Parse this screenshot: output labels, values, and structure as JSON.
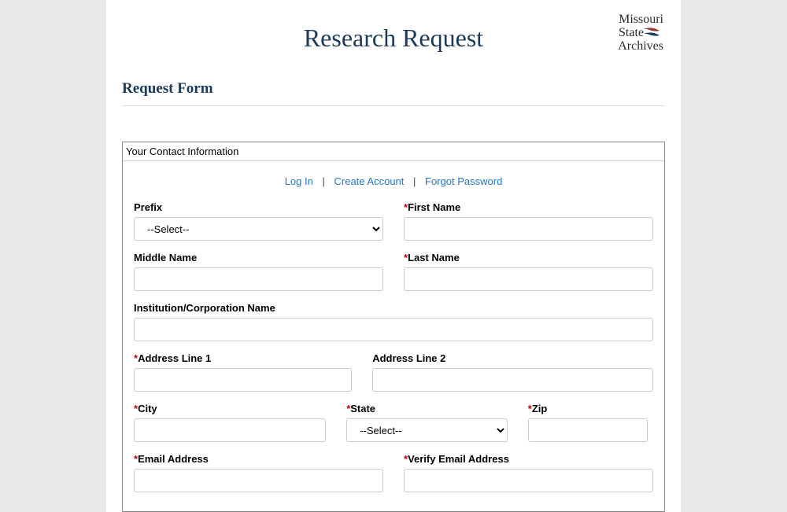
{
  "header": {
    "title": "Research Request",
    "logo_line1": "Missouri",
    "logo_line2": "State",
    "logo_line3": "Archives",
    "subhead": "Request Form"
  },
  "panel": {
    "title": "Your Contact Information"
  },
  "auth": {
    "login": "Log In",
    "create": "Create Account",
    "forgot": "Forgot Password"
  },
  "fields": {
    "prefix": {
      "label": "Prefix",
      "required": false,
      "placeholder": "--Select--"
    },
    "first_name": {
      "label": "First Name",
      "required": true
    },
    "middle_name": {
      "label": "Middle Name",
      "required": false
    },
    "last_name": {
      "label": "Last Name",
      "required": true
    },
    "institution": {
      "label": "Institution/Corporation Name",
      "required": false
    },
    "address1": {
      "label": "Address Line 1",
      "required": true
    },
    "address2": {
      "label": "Address Line 2",
      "required": false
    },
    "city": {
      "label": "City",
      "required": true
    },
    "state": {
      "label": "State",
      "required": true,
      "placeholder": "--Select--"
    },
    "zip": {
      "label": "Zip",
      "required": true
    },
    "email": {
      "label": "Email Address",
      "required": true
    },
    "verify_email": {
      "label": "Verify Email Address",
      "required": true
    }
  }
}
